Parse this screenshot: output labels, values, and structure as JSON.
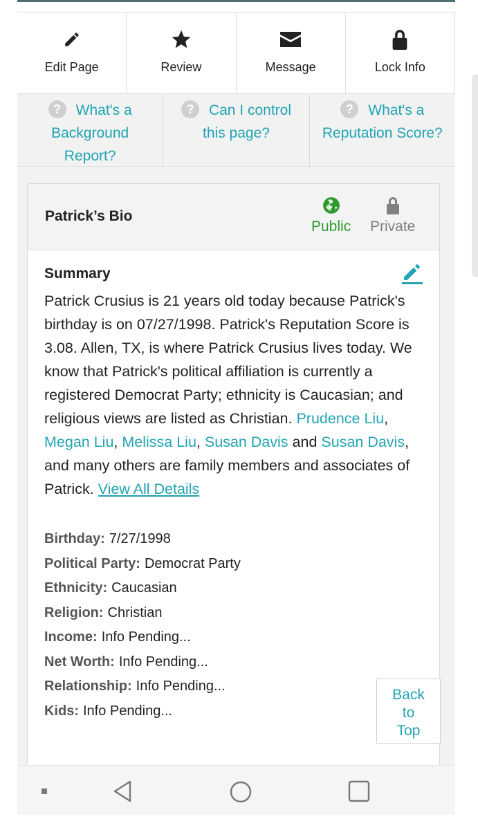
{
  "actions": [
    {
      "label": "Edit Page",
      "icon": "pencil-icon"
    },
    {
      "label": "Review",
      "icon": "star-icon"
    },
    {
      "label": "Message",
      "icon": "envelope-icon"
    },
    {
      "label": "Lock Info",
      "icon": "lock-icon"
    }
  ],
  "help": [
    {
      "text": "What's a Background Report?"
    },
    {
      "text": "Can I control this page?"
    },
    {
      "text": "What's a Reputation Score?"
    }
  ],
  "bio": {
    "title": "Patrick’s Bio",
    "public_label": "Public",
    "private_label": "Private",
    "summary_title": "Summary",
    "summary_intro": "Patrick Crusius is 21 years old today because Patrick's birthday is on 07/27/1998. Patrick's Reputation Score is 3.08. Allen, TX, is where Patrick Crusius lives today. We know that Patrick's political affiliation is currently a registered Democrat Party; ethnicity is Caucasian; and religious views are listed as Christian. ",
    "links": [
      "Prudence Liu",
      "Megan Liu",
      "Melissa Liu",
      "Susan Davis",
      "Susan Davis"
    ],
    "sep1": ", ",
    "sep2": ", ",
    "sep3": ", ",
    "sep4": " and ",
    "summary_tail": ", and many others are family members and associates of Patrick. ",
    "view_all": "View All Details",
    "facts": [
      {
        "k": "Birthday:",
        "v": "7/27/1998"
      },
      {
        "k": "Political Party:",
        "v": "Democrat Party"
      },
      {
        "k": "Ethnicity:",
        "v": "Caucasian"
      },
      {
        "k": "Religion:",
        "v": "Christian"
      },
      {
        "k": "Income:",
        "v": "Info Pending..."
      },
      {
        "k": "Net Worth:",
        "v": "Info Pending..."
      },
      {
        "k": "Relationship:",
        "v": "Info Pending..."
      },
      {
        "k": "Kids:",
        "v": "Info Pending..."
      }
    ]
  },
  "back_to_top": {
    "line1": "Back",
    "line2": "to",
    "line3": "Top"
  },
  "colors": {
    "link": "#21a4b3",
    "public": "#2e9a2e",
    "private": "#808080"
  },
  "nav_icons": [
    "recents-dot-icon",
    "back-icon",
    "home-icon",
    "overview-icon"
  ]
}
